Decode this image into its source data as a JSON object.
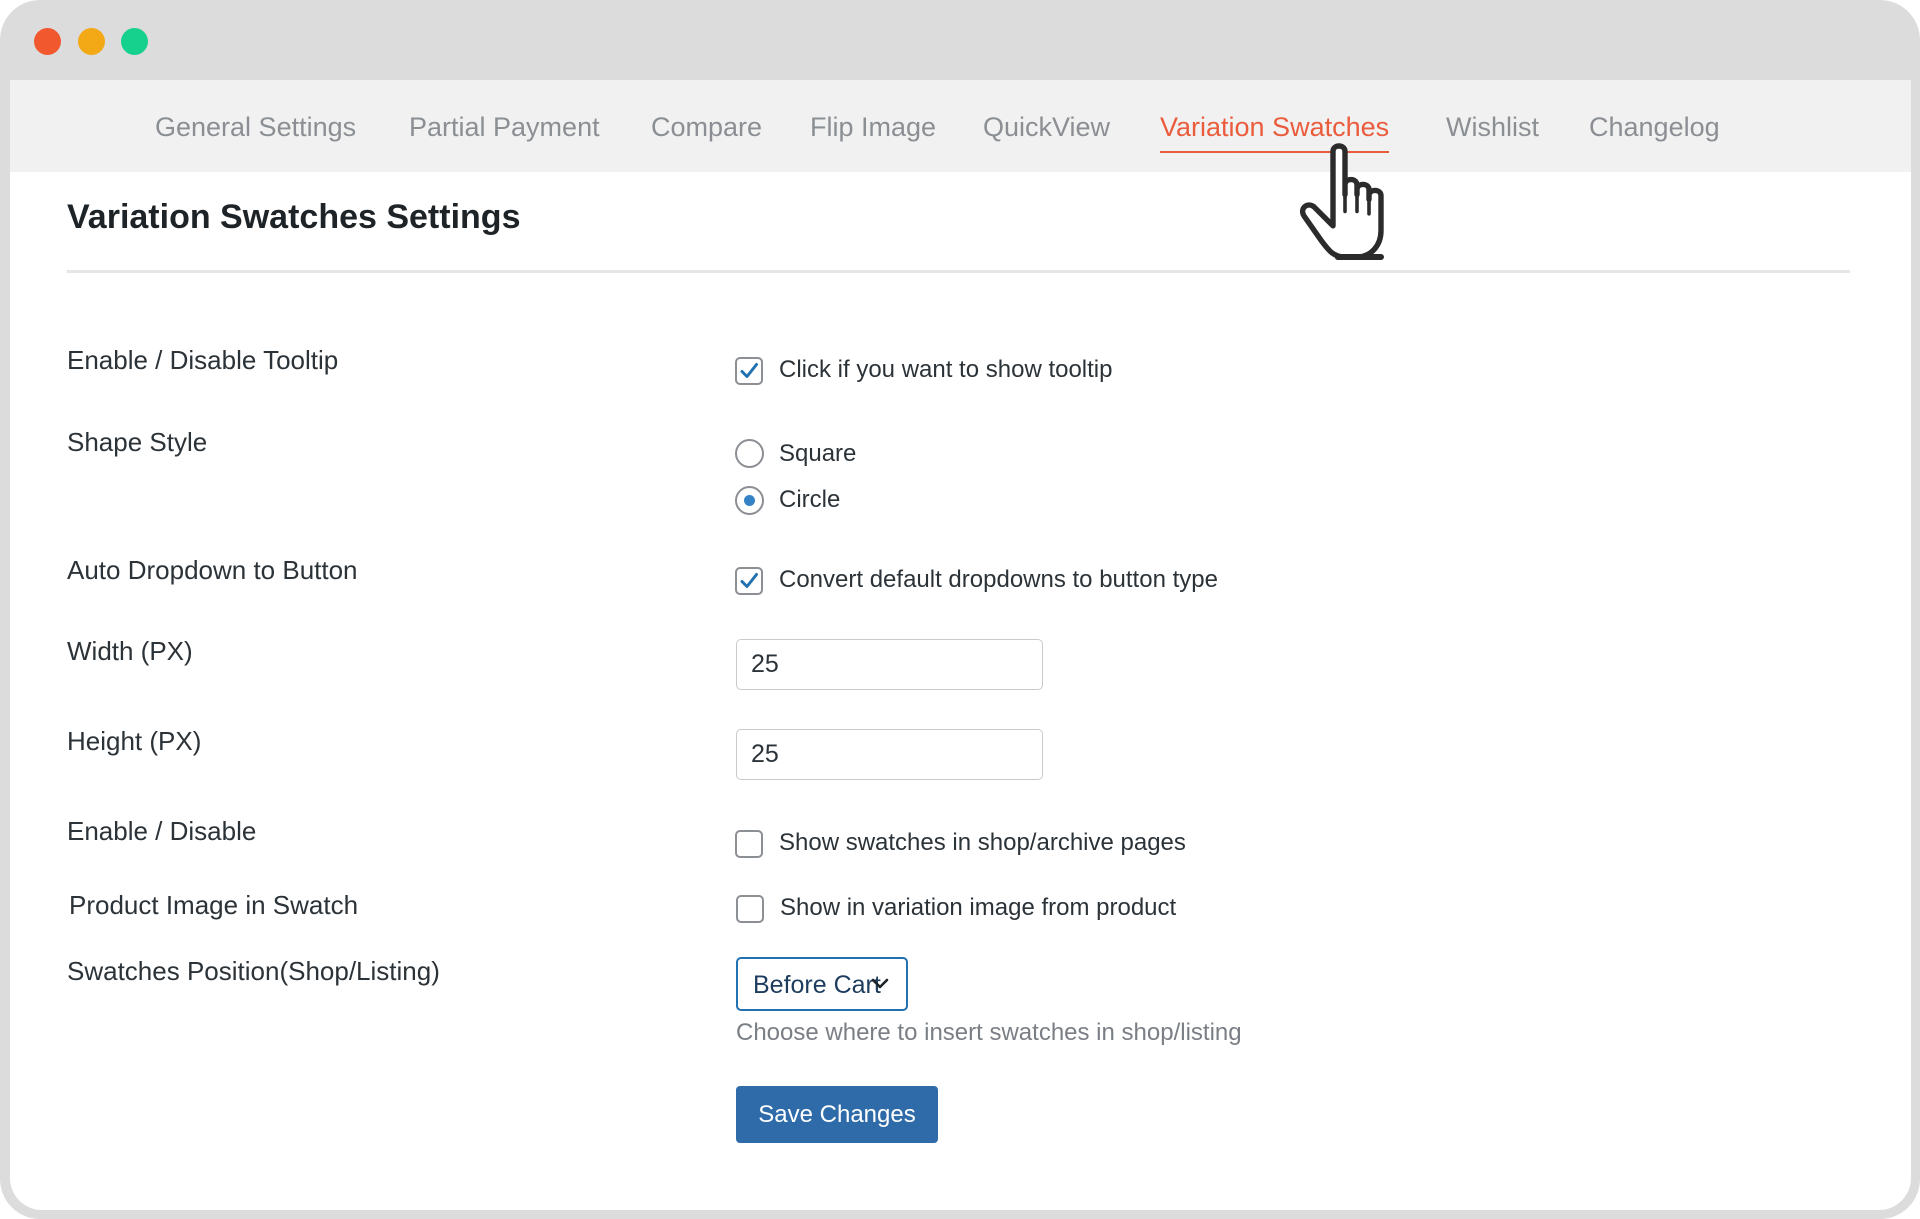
{
  "window_controls": {
    "close": "#f2582d",
    "minimize": "#f3a915",
    "maximize": "#16d08e"
  },
  "tabs": [
    {
      "label": "General Settings"
    },
    {
      "label": "Partial Payment"
    },
    {
      "label": "Compare"
    },
    {
      "label": "Flip Image"
    },
    {
      "label": "QuickView"
    },
    {
      "label": "Variation Swatches",
      "active": true
    },
    {
      "label": "Wishlist"
    },
    {
      "label": "Changelog"
    }
  ],
  "accent_color": "#ea5c3c",
  "page_title": "Variation Swatches Settings",
  "fields": {
    "tooltip": {
      "label": "Enable / Disable Tooltip",
      "text": "Click if you want to show tooltip",
      "checked": true
    },
    "shape": {
      "label": "Shape Style",
      "options": [
        "Square",
        "Circle"
      ],
      "selected": "Circle"
    },
    "auto_dropdown": {
      "label": "Auto Dropdown to Button",
      "text": "Convert default dropdowns to button type",
      "checked": true
    },
    "width": {
      "label": "Width (PX)",
      "value": "25"
    },
    "height": {
      "label": "Height (PX)",
      "value": "25"
    },
    "enable": {
      "label": "Enable / Disable",
      "text": "Show swatches in shop/archive pages",
      "checked": false
    },
    "product_image": {
      "label": "Product Image in Swatch",
      "text": "Show in variation image from product",
      "checked": false
    },
    "position": {
      "label": "Swatches Position(Shop/Listing)",
      "selected": "Before Cart",
      "help": "Choose where to insert swatches in shop/listing"
    }
  },
  "save_button": "Save Changes",
  "icons": {
    "cursor": "hand-pointer-icon",
    "checkmark": "check-icon",
    "dropdown": "chevron-down-icon"
  }
}
